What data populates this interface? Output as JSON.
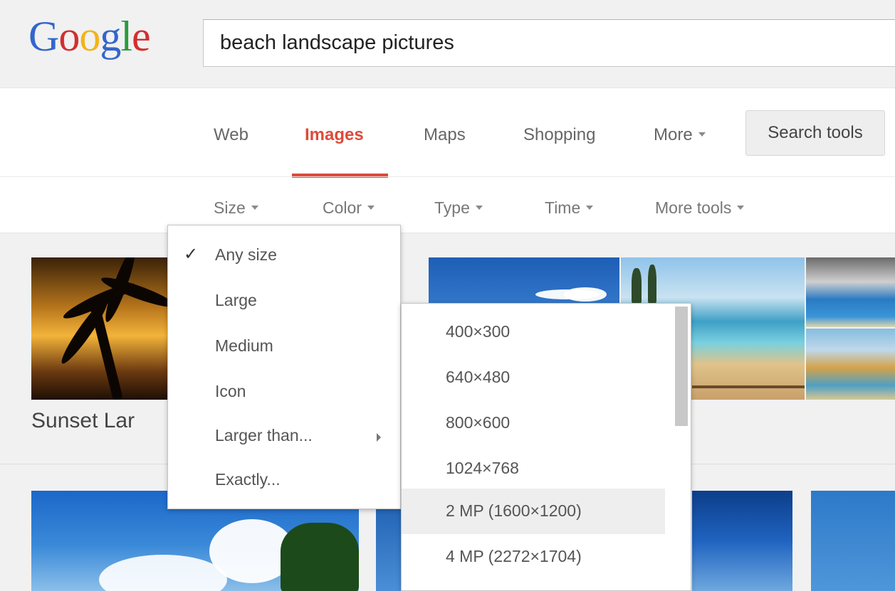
{
  "header": {
    "logo": {
      "letters": [
        "G",
        "o",
        "o",
        "g",
        "l",
        "e"
      ]
    },
    "search": {
      "value": "beach landscape pictures"
    }
  },
  "nav": {
    "tabs": [
      {
        "label": "Web",
        "active": false
      },
      {
        "label": "Images",
        "active": true
      },
      {
        "label": "Maps",
        "active": false
      },
      {
        "label": "Shopping",
        "active": false
      },
      {
        "label": "More",
        "active": false
      }
    ],
    "search_tools": "Search tools"
  },
  "tools": [
    "Size",
    "Color",
    "Type",
    "Time",
    "More tools"
  ],
  "size_menu": {
    "items": [
      {
        "label": "Any size",
        "checked": true
      },
      {
        "label": "Large",
        "checked": false
      },
      {
        "label": "Medium",
        "checked": false
      },
      {
        "label": "Icon",
        "checked": false
      },
      {
        "label": "Larger than...",
        "checked": false,
        "has_submenu": true
      },
      {
        "label": "Exactly...",
        "checked": false
      }
    ],
    "check_icon": "checkmark-icon",
    "submenu_arrow_icon": "chevron-right-icon"
  },
  "larger_than_submenu": {
    "items": [
      {
        "label": "400×300",
        "highlighted": false
      },
      {
        "label": "640×480",
        "highlighted": false
      },
      {
        "label": "800×600",
        "highlighted": false
      },
      {
        "label": "1024×768",
        "highlighted": false
      },
      {
        "label": "2 MP (1600×1200)",
        "highlighted": true
      },
      {
        "label": "4 MP (2272×1704)",
        "highlighted": false
      }
    ]
  },
  "results": {
    "first_caption": "Sunset Lar"
  },
  "colors": {
    "accent": "#dd4b39",
    "logo_blue": "#3366cc",
    "logo_red": "#d32f2f",
    "logo_yellow": "#f2b418",
    "logo_green": "#2a9a3e"
  }
}
